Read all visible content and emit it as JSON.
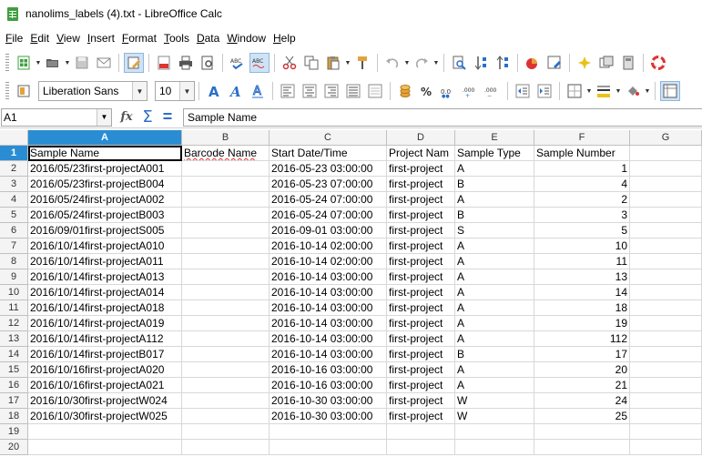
{
  "window": {
    "title": "nanolims_labels (4).txt - LibreOffice Calc"
  },
  "menu": [
    "File",
    "Edit",
    "View",
    "Insert",
    "Format",
    "Tools",
    "Data",
    "Window",
    "Help"
  ],
  "format_toolbar": {
    "font_name": "Liberation Sans",
    "font_size": "10"
  },
  "formula_bar": {
    "cell_ref": "A1",
    "content": "Sample Name"
  },
  "columns": [
    "A",
    "B",
    "C",
    "D",
    "E",
    "F",
    "G"
  ],
  "header_row": [
    "Sample Name",
    "Barcode Name",
    "Start Date/Time",
    "Project Nam",
    "Sample Type",
    "Sample Number",
    ""
  ],
  "rows": [
    [
      "2016/05/23first-projectA001",
      "",
      "2016-05-23 03:00:00",
      "first-project",
      "A",
      "1"
    ],
    [
      "2016/05/23first-projectB004",
      "",
      "2016-05-23 07:00:00",
      "first-project",
      "B",
      "4"
    ],
    [
      "2016/05/24first-projectA002",
      "",
      "2016-05-24 07:00:00",
      "first-project",
      "A",
      "2"
    ],
    [
      "2016/05/24first-projectB003",
      "",
      "2016-05-24 07:00:00",
      "first-project",
      "B",
      "3"
    ],
    [
      "2016/09/01first-projectS005",
      "",
      "2016-09-01 03:00:00",
      "first-project",
      "S",
      "5"
    ],
    [
      "2016/10/14first-projectA010",
      "",
      "2016-10-14 02:00:00",
      "first-project",
      "A",
      "10"
    ],
    [
      "2016/10/14first-projectA011",
      "",
      "2016-10-14 02:00:00",
      "first-project",
      "A",
      "11"
    ],
    [
      "2016/10/14first-projectA013",
      "",
      "2016-10-14 03:00:00",
      "first-project",
      "A",
      "13"
    ],
    [
      "2016/10/14first-projectA014",
      "",
      "2016-10-14 03:00:00",
      "first-project",
      "A",
      "14"
    ],
    [
      "2016/10/14first-projectA018",
      "",
      "2016-10-14 03:00:00",
      "first-project",
      "A",
      "18"
    ],
    [
      "2016/10/14first-projectA019",
      "",
      "2016-10-14 03:00:00",
      "first-project",
      "A",
      "19"
    ],
    [
      "2016/10/14first-projectA112",
      "",
      "2016-10-14 03:00:00",
      "first-project",
      "A",
      "112"
    ],
    [
      "2016/10/14first-projectB017",
      "",
      "2016-10-14 03:00:00",
      "first-project",
      "B",
      "17"
    ],
    [
      "2016/10/16first-projectA020",
      "",
      "2016-10-16 03:00:00",
      "first-project",
      "A",
      "20"
    ],
    [
      "2016/10/16first-projectA021",
      "",
      "2016-10-16 03:00:00",
      "first-project",
      "A",
      "21"
    ],
    [
      "2016/10/30first-projectW024",
      "",
      "2016-10-30 03:00:00",
      "first-project",
      "W",
      "24"
    ],
    [
      "2016/10/30first-projectW025",
      "",
      "2016-10-30 03:00:00",
      "first-project",
      "W",
      "25"
    ]
  ],
  "empty_rows": [
    "19",
    "20"
  ],
  "row_numbers": [
    "1",
    "2",
    "3",
    "4",
    "5",
    "6",
    "7",
    "8",
    "9",
    "10",
    "11",
    "12",
    "13",
    "14",
    "15",
    "16",
    "17",
    "18"
  ],
  "colors": {
    "selection_header": "#2a8dd4",
    "app_icon": "#3f9f3f"
  }
}
